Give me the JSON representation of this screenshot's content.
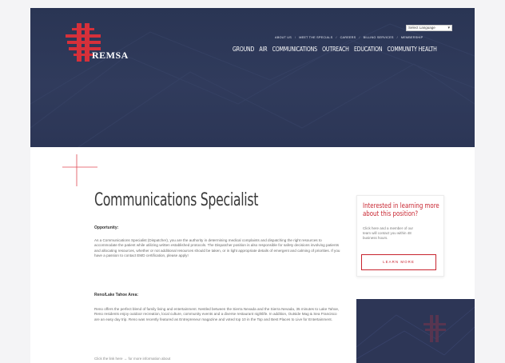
{
  "brand": {
    "name": "REMSA",
    "accent": "#c8242f",
    "navy": "#2d3656"
  },
  "header": {
    "language_select": "Select Language",
    "util_nav": [
      "ABOUT US",
      "MEET THE SPECIALS",
      "CAREERS",
      "BILLING SERVICES",
      "MEMBERSHIP"
    ],
    "main_nav": [
      "GROUND",
      "AIR",
      "COMMUNICATIONS",
      "OUTREACH",
      "EDUCATION",
      "COMMUNITY HEALTH"
    ]
  },
  "main": {
    "title": "Communications Specialist",
    "sections": [
      {
        "heading": "Opportunity:",
        "body": "As a Communications Specialist (Dispatcher), you are the authority in determining medical complaints and dispatching the right resources to accommodate the patient while utilizing written established protocols. The Dispatcher position is also responsible for safety decisions involving patients and allocating resources, whether or not additional resources should be taken, or in light appropriate details of emergent and calming of priorities. If you have a passion to contact EMD certification, please apply!"
      },
      {
        "heading": "Reno/Lake Tahoe Area:",
        "body": "Reno offers the perfect blend of family living and entertainment. Nestled between the Sierra Nevada and the Sierra Nevada, 35 minutes to Lake Tahoe, Reno residents enjoy outdoor recreation, local culture, community events and a diverse restaurant nightlife. In addition, Outside Mag & Sea Francisco are an easy day trip. Reno was recently featured as Entrepreneur magazine and voted top 10 in the Top and Best Places to Live for Entertainment."
      }
    ],
    "bottom_link": "Click the link here → for more information about"
  },
  "sidebar": {
    "title_line1": "Interested in learning more",
    "title_line2": "about this position?",
    "text": "Click here and a member of our team will contact you within 48 business hours.",
    "button_label": "LEARN MORE"
  }
}
